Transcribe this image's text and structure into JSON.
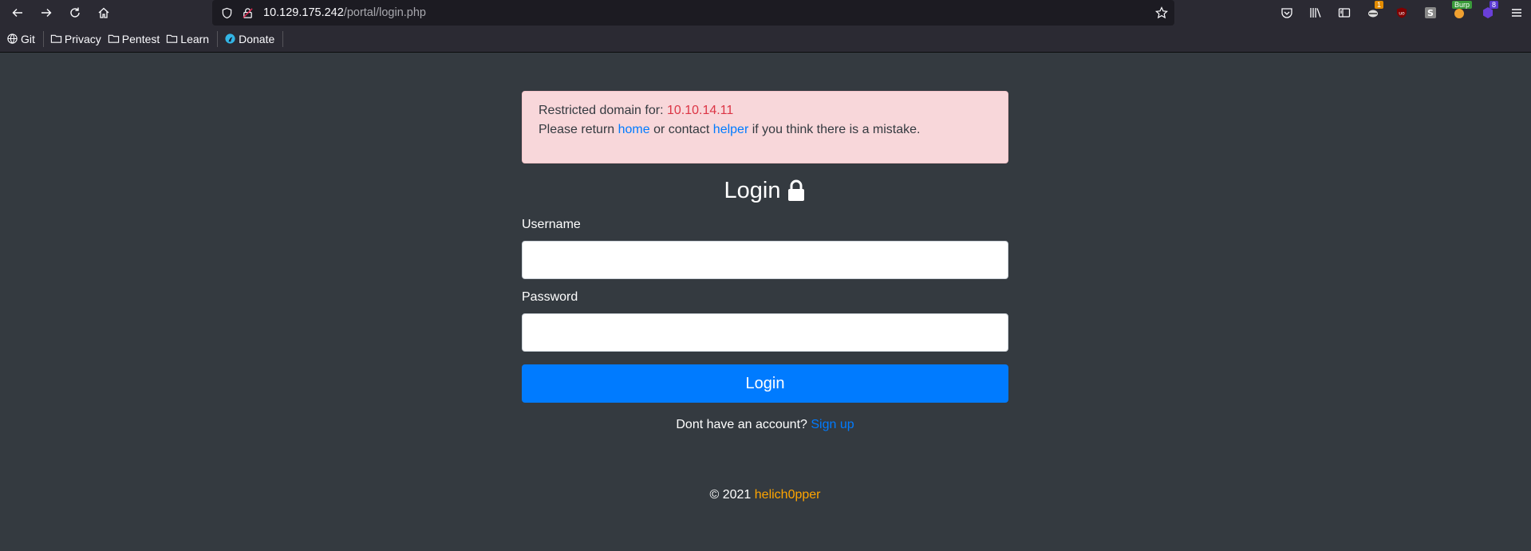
{
  "browser": {
    "url_host": "10.129.175.242",
    "url_path": "/portal/login.php",
    "bookmarks": [
      {
        "label": "Git",
        "icon": "globe-icon"
      },
      {
        "label": "Privacy",
        "icon": "folder-icon"
      },
      {
        "label": "Pentest",
        "icon": "folder-icon"
      },
      {
        "label": "Learn",
        "icon": "folder-icon"
      },
      {
        "label": "Donate",
        "icon": "parrot-icon"
      }
    ],
    "extension_badges": {
      "first": "1",
      "burp": "Burp",
      "last": "8"
    }
  },
  "alert": {
    "prefix": "Restricted domain for: ",
    "ip": "10.10.14.11",
    "line2_prefix": "Please return ",
    "home_link": "home",
    "line2_middle": " or contact ",
    "helper_link": "helper",
    "line2_suffix": " if you think there is a mistake."
  },
  "form": {
    "title": "Login",
    "username_label": "Username",
    "username_value": "",
    "password_label": "Password",
    "password_value": "",
    "submit_label": "Login",
    "signup_prompt": "Dont have an account? ",
    "signup_link": "Sign up"
  },
  "footer": {
    "copyright": "© 2021 ",
    "author": "helich0pper"
  },
  "colors": {
    "page_bg": "#343a40",
    "primary": "#007bff",
    "danger": "#dc3545",
    "alert_bg": "#f8d7da",
    "author": "#ffa500"
  }
}
